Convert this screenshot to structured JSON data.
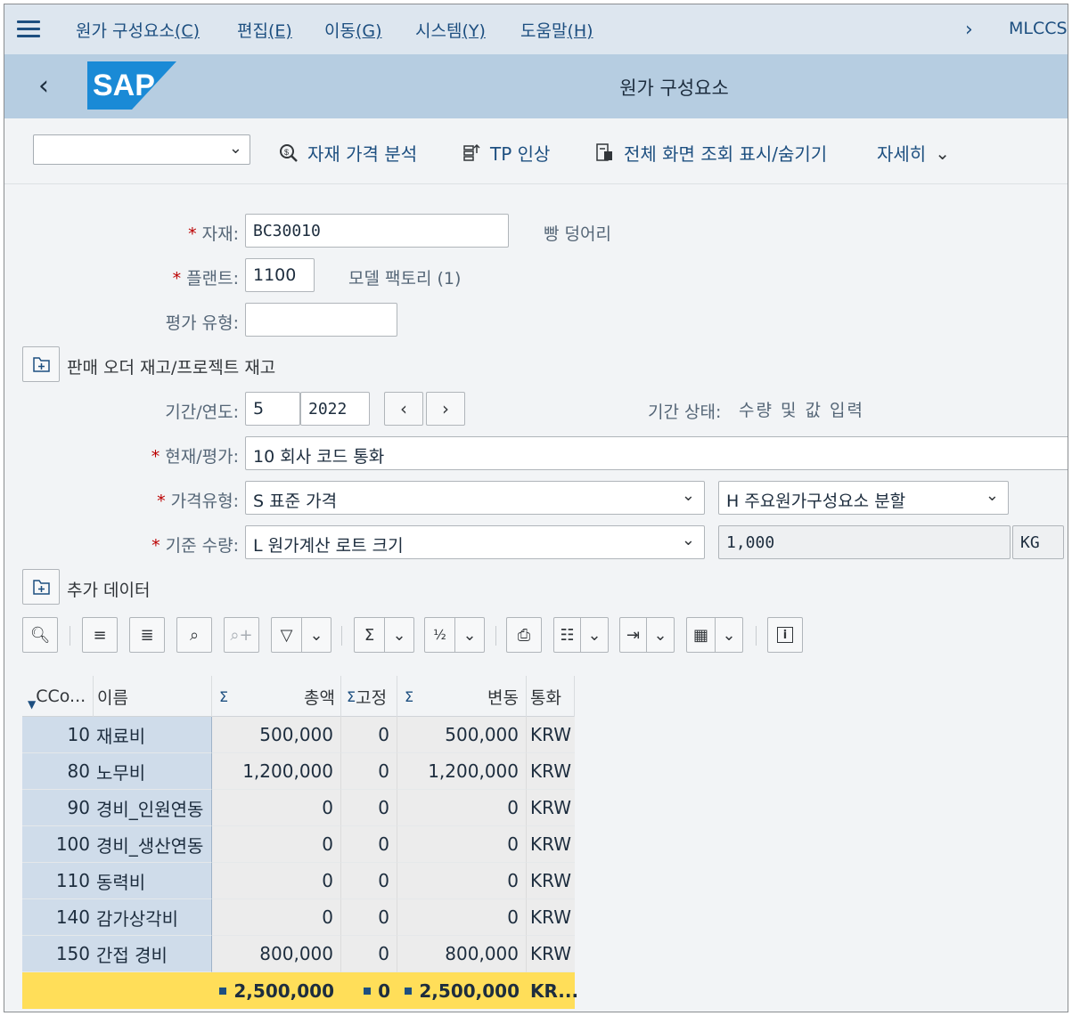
{
  "menubar": {
    "items": [
      {
        "label": "원가 구성요소",
        "key": "(C)"
      },
      {
        "label": "편집",
        "key": "(E)"
      },
      {
        "label": "이동",
        "key": "(G)"
      },
      {
        "label": "시스템",
        "key": "(Y)"
      },
      {
        "label": "도움말",
        "key": "(H)"
      }
    ],
    "system_id": "MLCCS"
  },
  "header": {
    "logo_text": "SAP",
    "title": "원가 구성요소"
  },
  "toolbar": {
    "dropdown_value": "",
    "material_price_analysis": "자재 가격 분석",
    "tp_increase": "TP 인상",
    "fullscreen_toggle": "전체 화면 조회 표시/숨기기",
    "more": "자세히"
  },
  "form": {
    "material": {
      "label": "자재:",
      "value": "BC30010",
      "description": "빵 덩어리"
    },
    "plant": {
      "label": "플랜트:",
      "value": "1100",
      "description": "모델 팩토리 (1)"
    },
    "valuation_type": {
      "label": "평가 유형:",
      "value": ""
    },
    "sales_order_stock": "판매 오더 재고/프로젝트 재고",
    "period": {
      "label": "기간/연도:",
      "period": "5",
      "year": "2022"
    },
    "period_status": {
      "label": "기간 상태:",
      "value": "수량 및 값 입력"
    },
    "currency_valuation": {
      "label": "현재/평가:",
      "value": "10 회사 코드 통화"
    },
    "price_type": {
      "label": "가격유형:",
      "value": "S 표준 가격",
      "split_value": "H 주요원가구성요소 분할"
    },
    "base_quantity": {
      "label": "기준 수량:",
      "value": "L 원가계산 로트 크기",
      "quantity": "1,000",
      "unit": "KG"
    },
    "additional_data": "추가 데이터"
  },
  "grid": {
    "headers": {
      "cc": "CCo...",
      "name": "이름",
      "total": "총액",
      "fixed": "고정",
      "variable": "변동",
      "currency": "통화",
      "sigma": "Σ"
    },
    "rows": [
      {
        "cc": "10",
        "name": "재료비",
        "total": "500,000",
        "fixed": "0",
        "variable": "500,000",
        "currency": "KRW"
      },
      {
        "cc": "80",
        "name": "노무비",
        "total": "1,200,000",
        "fixed": "0",
        "variable": "1,200,000",
        "currency": "KRW"
      },
      {
        "cc": "90",
        "name": "경비_인원연동",
        "total": "0",
        "fixed": "0",
        "variable": "0",
        "currency": "KRW"
      },
      {
        "cc": "100",
        "name": "경비_생산연동",
        "total": "0",
        "fixed": "0",
        "variable": "0",
        "currency": "KRW"
      },
      {
        "cc": "110",
        "name": "동력비",
        "total": "0",
        "fixed": "0",
        "variable": "0",
        "currency": "KRW"
      },
      {
        "cc": "140",
        "name": "감가상각비",
        "total": "0",
        "fixed": "0",
        "variable": "0",
        "currency": "KRW"
      },
      {
        "cc": "150",
        "name": "간접 경비",
        "total": "800,000",
        "fixed": "0",
        "variable": "800,000",
        "currency": "KRW"
      }
    ],
    "totals": {
      "total": "2,500,000",
      "fixed": "0",
      "variable": "2,500,000",
      "currency": "KR..."
    }
  },
  "colors": {
    "menubar_bg": "#dde6ef",
    "header_bg": "#b6cde1",
    "link": "#1d4f80",
    "required": "#bb0000",
    "key_col": "#cfdcea",
    "total_row": "#ffde59"
  }
}
